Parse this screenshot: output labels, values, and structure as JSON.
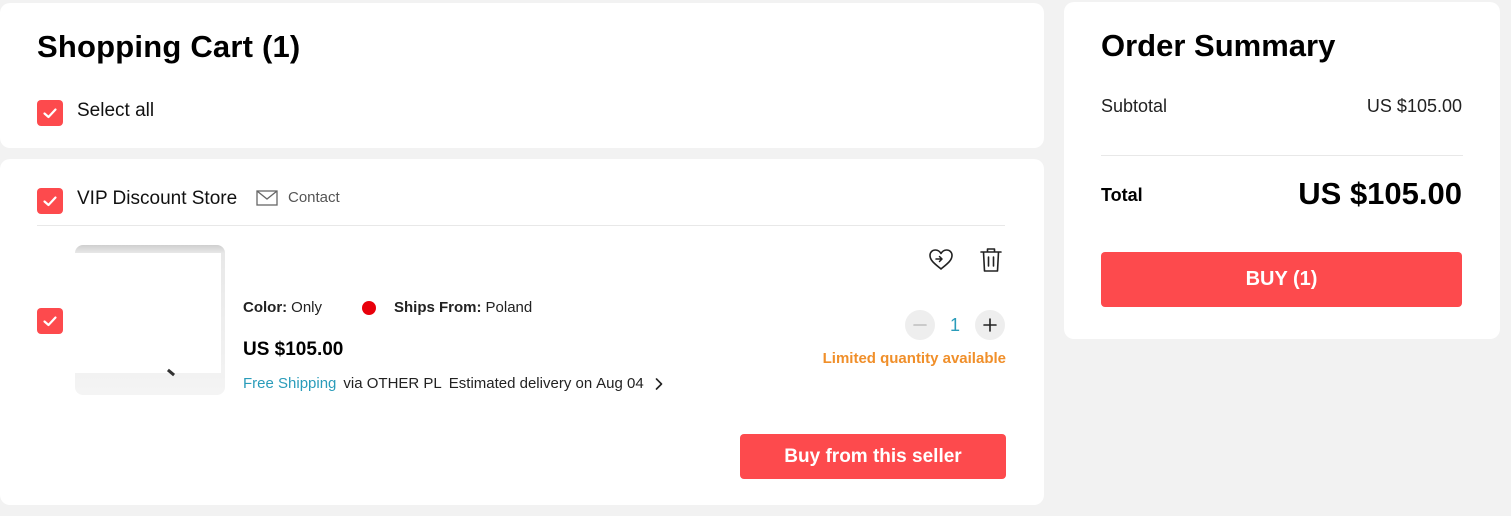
{
  "cart": {
    "title": "Shopping Cart (1)",
    "select_all_label": "Select all"
  },
  "store": {
    "name": "VIP Discount Store",
    "contact_label": "Contact",
    "item": {
      "color_key": "Color:",
      "color_value": "Only",
      "ships_from_key": "Ships From:",
      "ships_from_value": "Poland",
      "price": "US $105.00",
      "free_shipping": "Free Shipping",
      "carrier": "via OTHER PL",
      "delivery_prefix": "Estimated delivery on",
      "delivery_date": "Aug 04",
      "quantity": "1",
      "limited_note": "Limited quantity available"
    },
    "buy_from_seller_label": "Buy from this seller"
  },
  "summary": {
    "title": "Order Summary",
    "subtotal_label": "Subtotal",
    "subtotal_value": "US $105.00",
    "total_label": "Total",
    "total_value": "US $105.00",
    "buy_label": "BUY (1)"
  },
  "icons": {
    "checkbox": "check-icon",
    "contact": "envelope-icon",
    "wishlist": "heart-arrow-icon",
    "delete": "trash-icon",
    "decrease": "minus-icon",
    "increase": "plus-icon",
    "delivery_more": "chevron-right-icon"
  },
  "colors": {
    "accent": "#fd4a4d",
    "link": "#2a9cba",
    "warning": "#f08f2a",
    "dot": "#e8000b"
  }
}
